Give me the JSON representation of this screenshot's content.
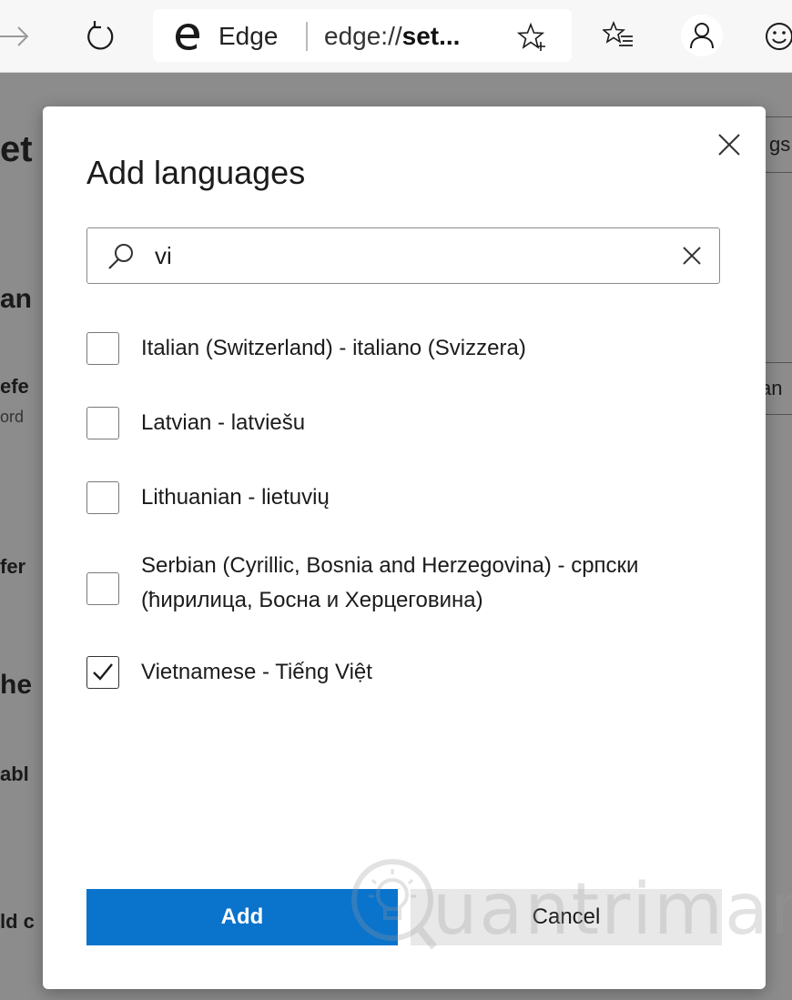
{
  "browser": {
    "brand": "Edge",
    "url_prefix": "edge://",
    "url_bold": "set...",
    "icons": [
      "back-arrow-icon",
      "refresh-icon",
      "edge-logo-icon",
      "add-favorite-star-icon",
      "favorites-icon",
      "profile-icon",
      "emoji-icon"
    ]
  },
  "background_page": {
    "fragments": [
      "et",
      "an",
      "efe",
      "ord",
      "fer",
      "he",
      "abl",
      "ld c"
    ],
    "right_fragments": [
      "gs",
      "an"
    ]
  },
  "dialog": {
    "title": "Add languages",
    "search": {
      "value": "vi",
      "placeholder": ""
    },
    "languages": [
      {
        "label": "Italian (Switzerland) - italiano (Svizzera)",
        "checked": false
      },
      {
        "label": "Latvian - latviešu",
        "checked": false
      },
      {
        "label": "Lithuanian - lietuvių",
        "checked": false
      },
      {
        "label": "Serbian (Cyrillic, Bosnia and Herzegovina) - српски (ћирилица, Босна и Херцеговина)",
        "checked": false
      },
      {
        "label": "Vietnamese - Tiếng Việt",
        "checked": true
      }
    ],
    "add_label": "Add",
    "cancel_label": "Cancel",
    "accent_color": "#0a73cc"
  },
  "watermark": {
    "text": "uantrimang"
  }
}
